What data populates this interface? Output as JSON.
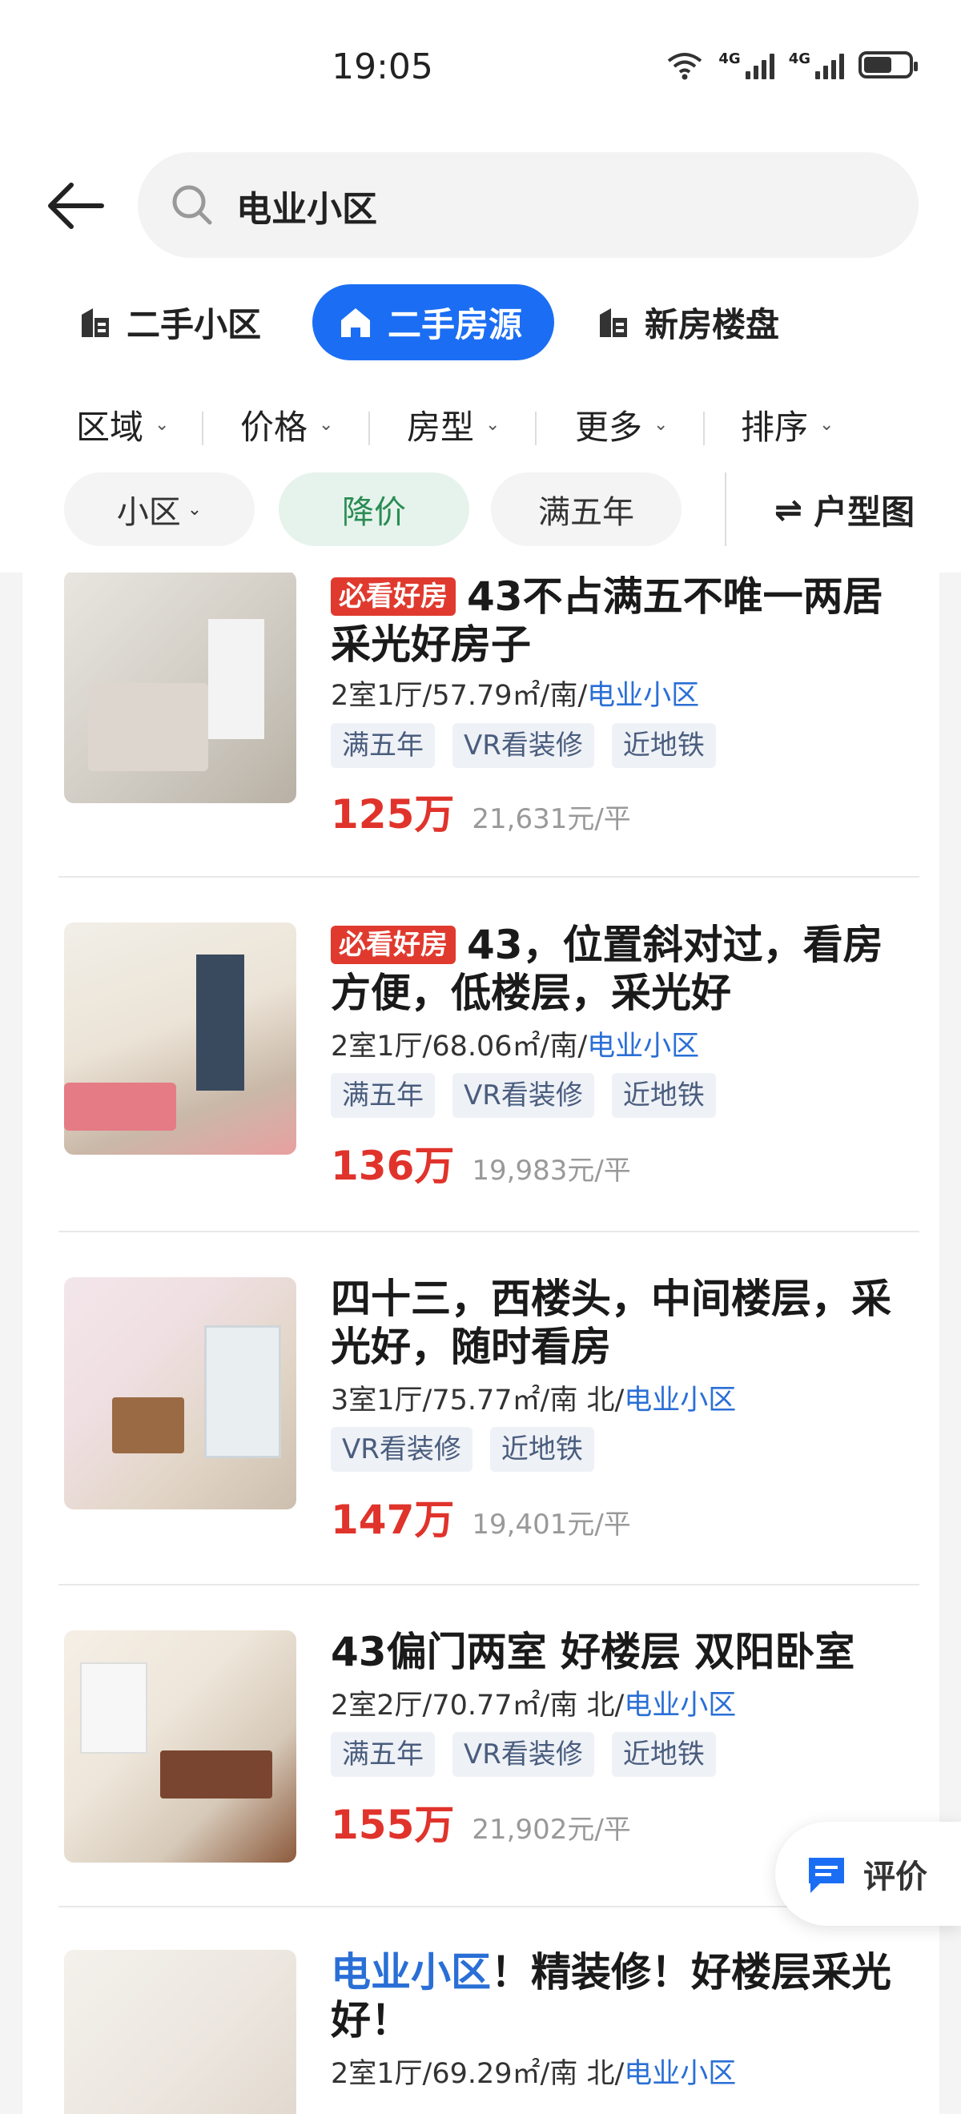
{
  "status_bar": {
    "time": "19:05",
    "net1": "4G",
    "net2": "4G"
  },
  "search": {
    "query": "电业小区"
  },
  "categories": [
    {
      "label": "二手小区",
      "icon": "building-icon",
      "active": false
    },
    {
      "label": "二手房源",
      "icon": "house-icon",
      "active": true
    },
    {
      "label": "新房楼盘",
      "icon": "building-icon",
      "active": false
    }
  ],
  "filters": [
    {
      "label": "区域"
    },
    {
      "label": "价格"
    },
    {
      "label": "房型"
    },
    {
      "label": "更多"
    },
    {
      "label": "排序"
    }
  ],
  "chips": [
    {
      "label": "小区"
    },
    {
      "label": "降价",
      "selected": true
    },
    {
      "label": "满五年"
    }
  ],
  "floorplan_label": "户型图",
  "listings": [
    {
      "badge": "必看好房",
      "title": "43不占满五不唯一两居采光好房子",
      "layout": "2室1厅/57.79㎡/南/",
      "community": "电业小区",
      "tags": [
        "满五年",
        "VR看装修",
        "近地铁"
      ],
      "price": "125万",
      "unit_price": "21,631元/平"
    },
    {
      "badge": "必看好房",
      "title": "43，位置斜对过，看房方便，低楼层，采光好",
      "layout": "2室1厅/68.06㎡/南/",
      "community": "电业小区",
      "tags": [
        "满五年",
        "VR看装修",
        "近地铁"
      ],
      "price": "136万",
      "unit_price": "19,983元/平"
    },
    {
      "badge": "",
      "title": "四十三，西楼头，中间楼层，采光好，随时看房",
      "layout": "3室1厅/75.77㎡/南 北/",
      "community": "电业小区",
      "tags": [
        "VR看装修",
        "近地铁"
      ],
      "price": "147万",
      "unit_price": "19,401元/平"
    },
    {
      "badge": "",
      "title": "43偏门两室 好楼层 双阳卧室",
      "layout": "2室2厅/70.77㎡/南 北/",
      "community": "电业小区",
      "tags": [
        "满五年",
        "VR看装修",
        "近地铁"
      ],
      "price": "155万",
      "unit_price": "21,902元/平"
    },
    {
      "badge": "",
      "title_hl": "电业小区",
      "title": "！精装修！好楼层采光好！",
      "layout": "2室1厅/69.29㎡/南 北/",
      "community": "电业小区",
      "tags": [],
      "price": "",
      "unit_price": ""
    }
  ],
  "review_label": "评价",
  "colors": {
    "accent": "#1b6ef3",
    "price": "#e0332b",
    "badge": "#e03a2f",
    "link": "#2a6fd6",
    "chip_selected": "#2a8c54"
  }
}
